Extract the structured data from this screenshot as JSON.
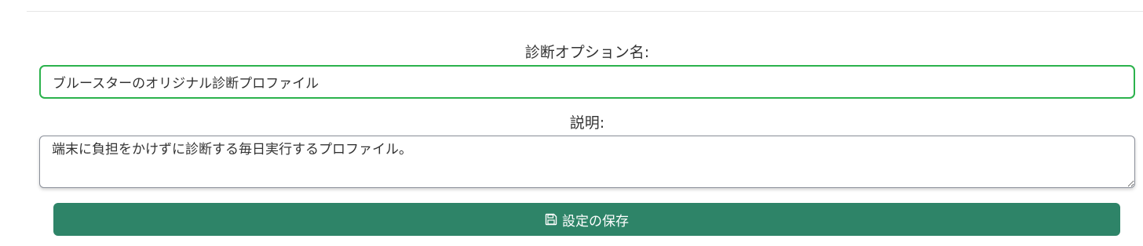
{
  "form": {
    "name_label": "診断オプション名:",
    "name_value": "ブルースターのオリジナル診断プロファイル",
    "description_label": "説明:",
    "description_value": "端末に負担をかけずに診断する毎日実行するプロファイル。",
    "save_label": "設定の保存",
    "save_icon": "save-icon"
  },
  "colors": {
    "input_focus_border": "#2bb24c",
    "button_background": "#2e8468",
    "button_text": "#ffffff"
  }
}
